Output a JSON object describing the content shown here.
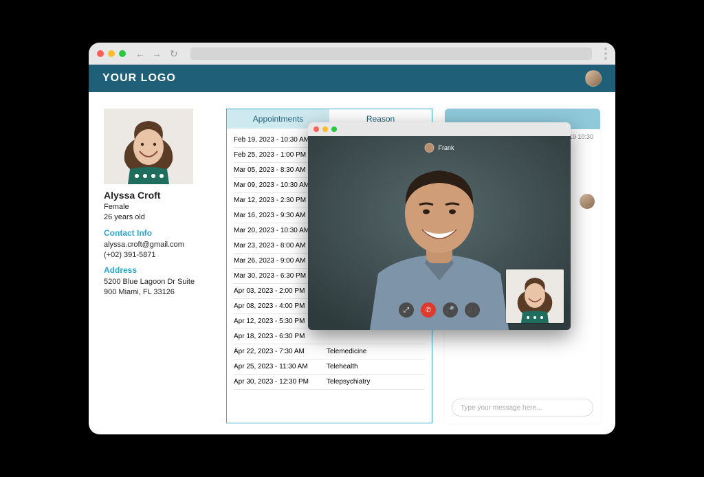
{
  "browser": {
    "back": "←",
    "forward": "→",
    "refresh": "↻"
  },
  "app": {
    "logo_text": "YOUR LOGO"
  },
  "patient": {
    "name": "Alyssa Croft",
    "gender": "Female",
    "age_line": "26 years old",
    "contact_title": "Contact Info",
    "email": "alyssa.croft@gmail.com",
    "phone": "(+02) 391-5871",
    "address_title": "Address",
    "address_line1": "5200 Blue Lagoon Dr Suite",
    "address_line2": "900 Miami, FL 33126"
  },
  "appointments": {
    "tab_appts": "Appointments",
    "tab_reason": "Reason",
    "rows": [
      {
        "dt": "Feb 19, 2023 - 10:30 AM",
        "rs": ""
      },
      {
        "dt": "Feb 25, 2023 - 1:00 PM",
        "rs": ""
      },
      {
        "dt": "Mar 05, 2023 - 8:30 AM",
        "rs": ""
      },
      {
        "dt": "Mar 09, 2023 - 10:30 AM",
        "rs": ""
      },
      {
        "dt": "Mar 12, 2023 - 2:30 PM",
        "rs": ""
      },
      {
        "dt": "Mar 16, 2023 - 9:30 AM",
        "rs": ""
      },
      {
        "dt": "Mar 20, 2023 - 10:30 AM",
        "rs": ""
      },
      {
        "dt": "Mar 23, 2023 - 8:00 AM",
        "rs": ""
      },
      {
        "dt": "Mar 26, 2023 - 9:00 AM",
        "rs": ""
      },
      {
        "dt": "Mar 30, 2023 - 6:30 PM",
        "rs": ""
      },
      {
        "dt": "Apr 03, 2023 - 2:00 PM",
        "rs": ""
      },
      {
        "dt": "Apr 08, 2023 - 4:00 PM",
        "rs": ""
      },
      {
        "dt": "Apr 12, 2023 - 5:30 PM",
        "rs": ""
      },
      {
        "dt": "Apr 18, 2023 - 6:30 PM",
        "rs": ""
      },
      {
        "dt": "Apr 22, 2023 - 7:30 AM",
        "rs": "Telemedicine"
      },
      {
        "dt": "Apr 25, 2023 - 11:30 AM",
        "rs": "Telehealth"
      },
      {
        "dt": "Apr 30, 2023 - 12:30 PM",
        "rs": "Telepsychiatry"
      }
    ]
  },
  "chat": {
    "timestamp_visible": "19 10:30",
    "input_placeholder": "Type your message here..."
  },
  "video_call": {
    "other_name": "Frank",
    "controls": {
      "expand": "⤢",
      "hangup": "✆",
      "mic": "🎤",
      "camera": "🎥"
    }
  }
}
